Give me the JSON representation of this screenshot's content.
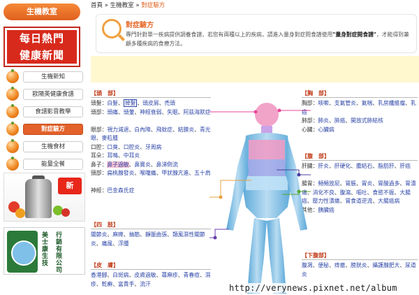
{
  "sidebar": {
    "header": "生機教室",
    "news_banner": [
      "每日熱門",
      "健康新聞"
    ],
    "menu": [
      {
        "label": "生機新知",
        "active": false
      },
      {
        "label": "歐陽英健康食譜",
        "active": false
      },
      {
        "label": "食譜影音教學",
        "active": false
      },
      {
        "label": "對症驗方",
        "active": true
      },
      {
        "label": "生機食材",
        "active": false
      },
      {
        "label": "能量全餐",
        "active": false
      }
    ],
    "juicer_badge": "新",
    "company": {
      "col1": "美士康生技",
      "col2": "行銷有限公司",
      "logo_label": "LOHAS"
    }
  },
  "breadcrumb": {
    "home": "首頁",
    "sep": "»",
    "section": "生機教室",
    "current": "對症驗方"
  },
  "intro": {
    "title": "對症驗方",
    "text_before": "專門針對單一疾病提供調養食譜，若您有兩種以上的疾病，請進入量身對症問食譜使用",
    "highlight": "\"量身對症開食譜\"",
    "text_after": "，才能得到兼顧多種疾病的食療方法。"
  },
  "left_sections": [
    {
      "title": "【頭　部】",
      "rows": [
        {
          "label": "頭髮：",
          "items": [
            "白髮",
            "掉髮",
            "頭皮屑",
            "禿頭"
          ]
        },
        {
          "label": "頭部：",
          "items": [
            "頭痛",
            "頭暈",
            "神經衰弱",
            "失眠",
            "阿茲海默症"
          ]
        },
        {
          "label": "眼部：",
          "items": [
            "視力減退",
            "白內障",
            "飛蚊症",
            "結膜炎",
            "青光眼",
            "麥粒腫"
          ]
        },
        {
          "label": "口腔：",
          "items": [
            "口臭",
            "口腔炎",
            "牙周病"
          ]
        },
        {
          "label": "耳朵：",
          "items": [
            "耳鳴",
            "中耳炎"
          ]
        },
        {
          "label": "鼻子：",
          "items": [
            "鼻子過敏",
            "鼻竇炎",
            "鼻涕倒流"
          ]
        },
        {
          "label": "頸部：",
          "items": [
            "扁桃腺發炎",
            "喉嚨痛",
            "甲狀腺亢進",
            "五十肩"
          ]
        },
        {
          "label": "神經：",
          "items": [
            "巴金森氏症"
          ]
        }
      ]
    },
    {
      "title": "【四　肢】",
      "rows": [
        {
          "label": "",
          "items": [
            "關節炎",
            "麻痺",
            "抽筋",
            "靜脈曲張",
            "類風濕性關節炎",
            "痛風",
            "浮腫"
          ]
        }
      ]
    },
    {
      "title": "【皮　膚】",
      "rows": [
        {
          "label": "",
          "items": [
            "香港腳",
            "白斑病",
            "皮膚過敏",
            "蕁麻疹",
            "青春痘",
            "濕疹",
            "乾癬",
            "富貴手",
            "流汗"
          ]
        }
      ]
    }
  ],
  "right_sections": [
    {
      "title": "【胸　部】",
      "rows": [
        {
          "label": "胸部：",
          "items": [
            "咳嗽",
            "支氣管炎",
            "氣喘",
            "乳房纖維瘤",
            "乳癌"
          ]
        },
        {
          "label": "肺部：",
          "items": [
            "肺炎",
            "肺癌",
            "開放式肺結核"
          ]
        },
        {
          "label": "心臟：",
          "items": [
            "心臟病"
          ]
        }
      ]
    },
    {
      "title": "【腹　部】",
      "rows": [
        {
          "label": "肝臟：",
          "items": [
            "肝炎",
            "肝硬化",
            "膽結石",
            "脂肪肝",
            "肝癌"
          ]
        },
        {
          "label": "腸胃：",
          "items": [
            "頻頻放屁",
            "胃脹",
            "胃炎",
            "胃酸過多",
            "胃潰瘍",
            "消化不良",
            "腹瀉",
            "嘔吐",
            "食慾不振",
            "大腸癌",
            "壓力性潰瘍",
            "胃食道逆流",
            "大腸癌病"
          ]
        },
        {
          "label": "其他：",
          "items": [
            "胰臟癌"
          ]
        }
      ]
    },
    {
      "title": "【下腹部】",
      "rows": [
        {
          "label": "",
          "items": [
            "腹凋",
            "便秘",
            "痔瘡",
            "膀胱炎",
            "攝護腺肥大",
            "尿道炎"
          ]
        }
      ]
    }
  ],
  "watermark": "http://verynews.pixnet.net/album",
  "colors": {
    "accent": "#e0601d",
    "link": "#2c45a7",
    "section_title": "#c03c1a",
    "ad_bar": "#fff8cf"
  }
}
